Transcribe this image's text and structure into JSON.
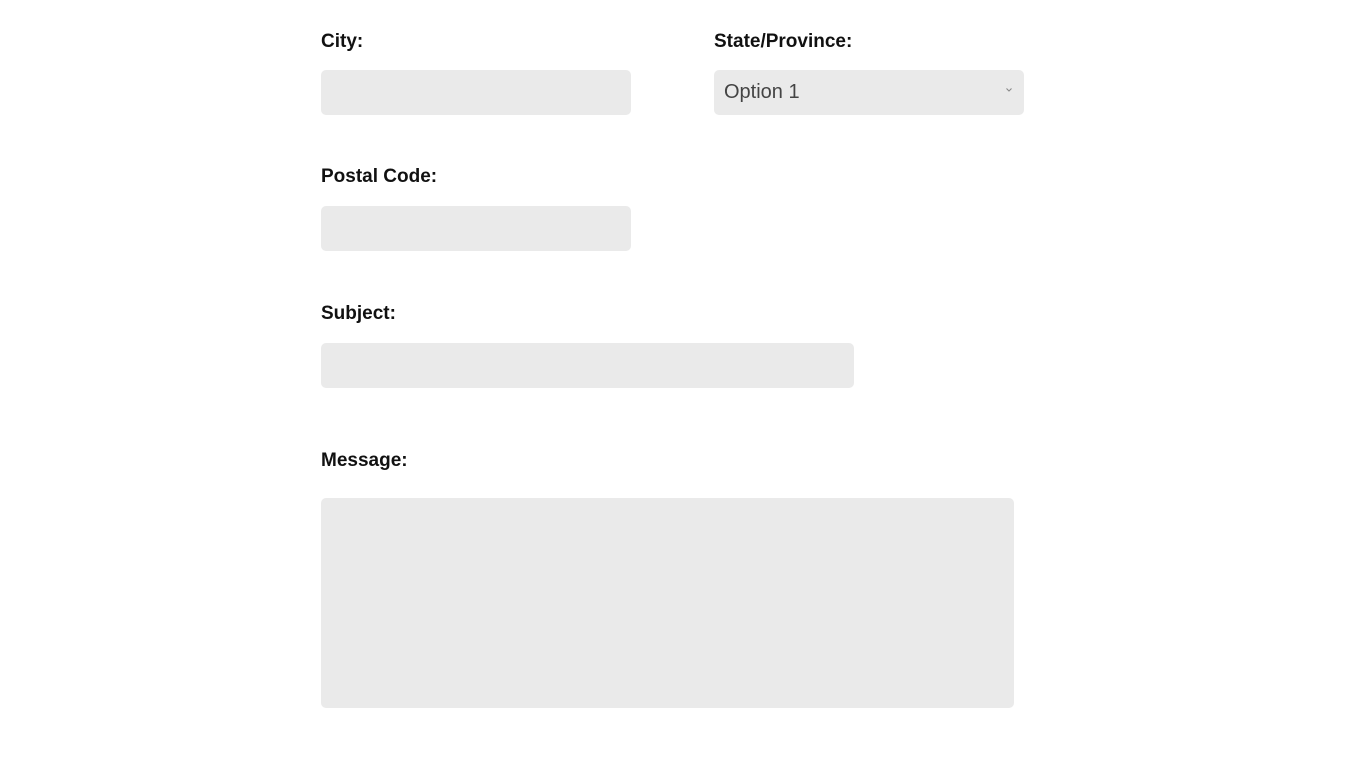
{
  "form": {
    "city": {
      "label": "City:",
      "value": ""
    },
    "state": {
      "label": "State/Province:",
      "selected": "Option 1",
      "icon": "chevron-down-icon"
    },
    "postal_code": {
      "label": "Postal Code:",
      "value": ""
    },
    "subject": {
      "label": "Subject:",
      "value": ""
    },
    "message": {
      "label": "Message:",
      "value": ""
    }
  },
  "colors": {
    "field_background": "#eaeaea",
    "label_text": "#111111",
    "page_background": "#ffffff"
  }
}
